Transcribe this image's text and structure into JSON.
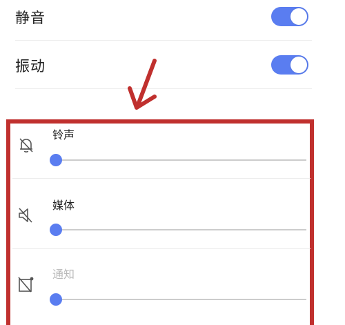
{
  "settings": {
    "mute": {
      "label": "静音",
      "enabled": true
    },
    "vibrate": {
      "label": "振动",
      "enabled": true
    }
  },
  "volumes": {
    "ringtone": {
      "label": "铃声",
      "icon": "bell-off-icon",
      "level": 0
    },
    "media": {
      "label": "媒体",
      "icon": "speaker-muted-icon",
      "level": 0
    },
    "notification": {
      "label": "通知",
      "icon": "notification-off-icon",
      "level": 0
    }
  },
  "colors": {
    "accent": "#5a7df0",
    "annotation": "#c0302e"
  }
}
